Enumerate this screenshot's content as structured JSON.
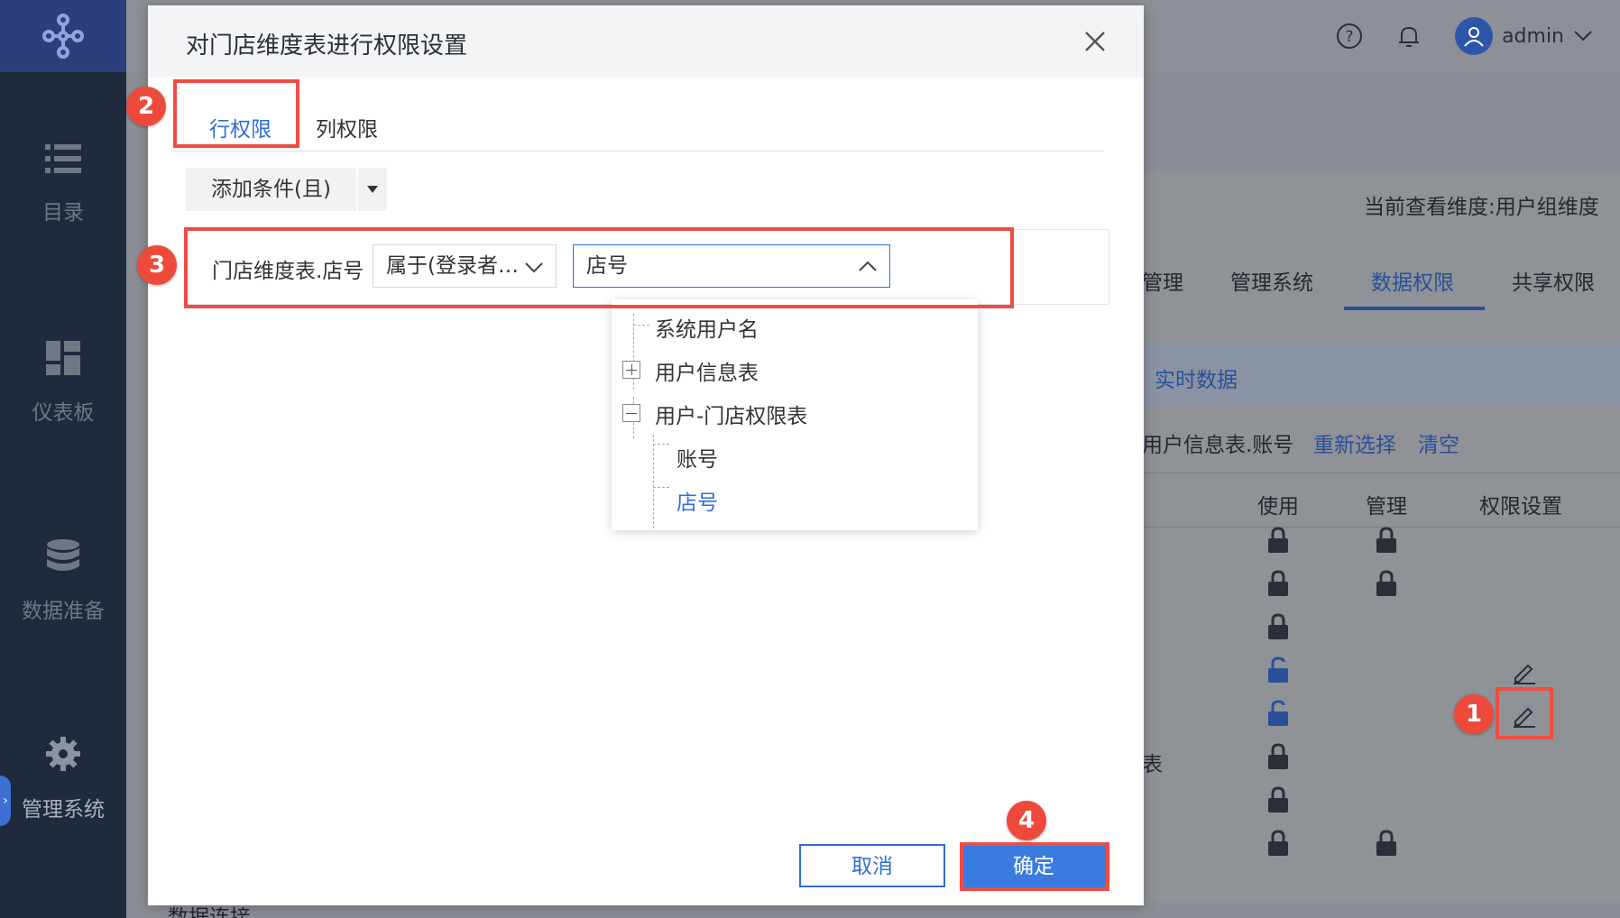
{
  "sidebar": {
    "items": [
      {
        "label": "目录",
        "icon": "list-icon"
      },
      {
        "label": "仪表板",
        "icon": "dashboard-icon"
      },
      {
        "label": "数据准备",
        "icon": "database-icon"
      },
      {
        "label": "管理系统",
        "icon": "gear-icon"
      }
    ],
    "collapse_glyph": "›"
  },
  "topbar": {
    "username": "admin"
  },
  "background": {
    "view_dimension": "当前查看维度:用户组维度",
    "tabs": [
      "管理",
      "管理系统",
      "数据权限",
      "共享权限"
    ],
    "section_title": "实时数据",
    "binding_field": "用户信息表.账号",
    "reselect": "重新选择",
    "clear": "清空",
    "table_headers": [
      "使用",
      "管理",
      "权限设置"
    ],
    "row_fragment": "表",
    "bottom_fragment": "数据连接"
  },
  "modal": {
    "title": "对门店维度表进行权限设置",
    "tabs": [
      "行权限",
      "列权限"
    ],
    "add_condition": "添加条件(且)",
    "condition": {
      "field": "门店维度表.店号",
      "operator": "属于(登录者…",
      "value": "店号"
    },
    "tree": [
      {
        "label": "系统用户名"
      },
      {
        "label": "用户信息表"
      },
      {
        "label": "用户-门店权限表"
      },
      {
        "label": "账号"
      },
      {
        "label": "店号"
      }
    ],
    "cancel": "取消",
    "confirm": "确定"
  },
  "annotations": [
    "1",
    "2",
    "3",
    "4"
  ],
  "colors": {
    "accent": "#2f6fd6",
    "highlight": "#ef4c43",
    "sidebar": "#1f2a3d"
  }
}
